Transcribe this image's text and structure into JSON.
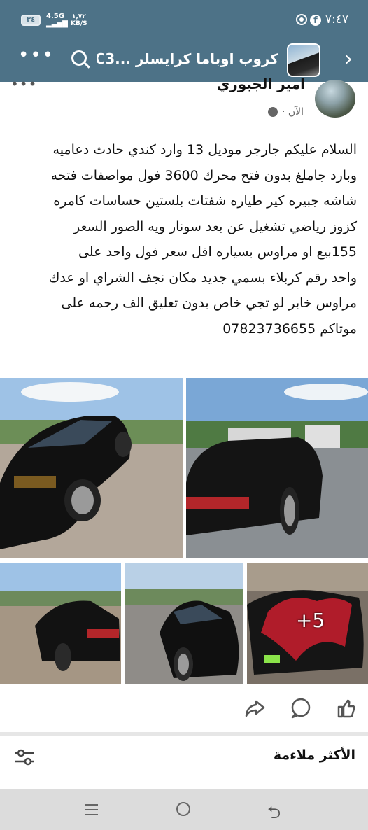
{
  "status_bar": {
    "time": "٧:٤٧",
    "battery": "٣٤",
    "signal_label": "4.5G",
    "speed_value": "١,٧٢",
    "speed_unit": "KB/S",
    "facebook_icon": "facebook-icon",
    "record_icon": "screen-record-icon"
  },
  "header": {
    "title": "كروب اوباما كرايسلر ...C3",
    "back_icon": "chevron-right-icon",
    "search_icon": "search-icon",
    "menu_icon": "more-horizontal-icon",
    "background": "#4d7287"
  },
  "post": {
    "author": "امير الجبوري",
    "time_label": "الآن ·",
    "privacy_icon": "globe-icon",
    "more_icon": "more-horizontal-icon",
    "text_lines": [
      "السلام عليكم جارجر موديل 13 وارد كندي حادث دعاميه",
      "وبارد جاملغ بدون فتح محرك 3600 فول مواصفات فتحه",
      "شاشه جبيره كير طياره شفتات بلستين حساسات كامره",
      "كزوز رياضي تشغيل عن بعد سونار ويه الصور السعر",
      "155بيع او مراوس بسياره اقل سعر فول واحد على",
      "واحد رقم كربلاء بسمي جديد مكان نجف الشراي او عدك",
      "مراوس خابر لو تجي خاص بدون تعليق الف رحمه على",
      "موتاكم 07823736655"
    ],
    "more_photos_label": "+5"
  },
  "actions": {
    "share_icon": "share-icon",
    "comment_icon": "comment-icon",
    "like_icon": "thumbs-up-icon"
  },
  "comments_sort": {
    "label": "الأكثر ملاءمة",
    "filter_icon": "sliders-icon"
  },
  "nav": {
    "menu_icon": "recent-apps-icon",
    "home_icon": "home-icon",
    "back_icon": "back-icon"
  }
}
